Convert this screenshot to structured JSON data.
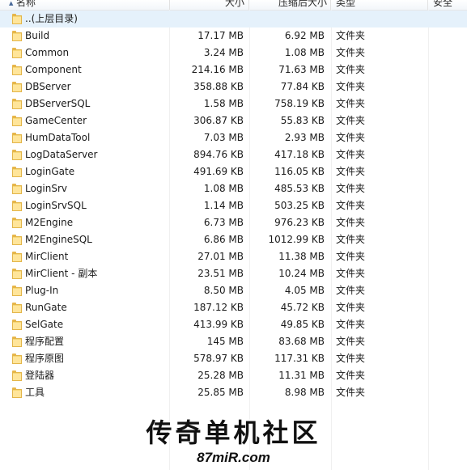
{
  "columns": {
    "name": "名称",
    "size": "大小",
    "compressed": "压缩后大小",
    "type": "类型",
    "security": "安全"
  },
  "parent": {
    "label": "..(上层目录)",
    "icon": "folder-icon"
  },
  "rows": [
    {
      "name": "Build",
      "size": "17.17 MB",
      "compressed": "6.92 MB",
      "type": "文件夹"
    },
    {
      "name": "Common",
      "size": "3.24 MB",
      "compressed": "1.08 MB",
      "type": "文件夹"
    },
    {
      "name": "Component",
      "size": "214.16 MB",
      "compressed": "71.63 MB",
      "type": "文件夹"
    },
    {
      "name": "DBServer",
      "size": "358.88 KB",
      "compressed": "77.84 KB",
      "type": "文件夹"
    },
    {
      "name": "DBServerSQL",
      "size": "1.58 MB",
      "compressed": "758.19 KB",
      "type": "文件夹"
    },
    {
      "name": "GameCenter",
      "size": "306.87 KB",
      "compressed": "55.83 KB",
      "type": "文件夹"
    },
    {
      "name": "HumDataTool",
      "size": "7.03 MB",
      "compressed": "2.93 MB",
      "type": "文件夹"
    },
    {
      "name": "LogDataServer",
      "size": "894.76 KB",
      "compressed": "417.18 KB",
      "type": "文件夹"
    },
    {
      "name": "LoginGate",
      "size": "491.69 KB",
      "compressed": "116.05 KB",
      "type": "文件夹"
    },
    {
      "name": "LoginSrv",
      "size": "1.08 MB",
      "compressed": "485.53 KB",
      "type": "文件夹"
    },
    {
      "name": "LoginSrvSQL",
      "size": "1.14 MB",
      "compressed": "503.25 KB",
      "type": "文件夹"
    },
    {
      "name": "M2Engine",
      "size": "6.73 MB",
      "compressed": "976.23 KB",
      "type": "文件夹"
    },
    {
      "name": "M2EngineSQL",
      "size": "6.86 MB",
      "compressed": "1012.99 KB",
      "type": "文件夹"
    },
    {
      "name": "MirClient",
      "size": "27.01 MB",
      "compressed": "11.38 MB",
      "type": "文件夹"
    },
    {
      "name": "MirClient - 副本",
      "size": "23.51 MB",
      "compressed": "10.24 MB",
      "type": "文件夹"
    },
    {
      "name": "Plug-In",
      "size": "8.50 MB",
      "compressed": "4.05 MB",
      "type": "文件夹"
    },
    {
      "name": "RunGate",
      "size": "187.12 KB",
      "compressed": "45.72 KB",
      "type": "文件夹"
    },
    {
      "name": "SelGate",
      "size": "413.99 KB",
      "compressed": "49.85 KB",
      "type": "文件夹"
    },
    {
      "name": "程序配置",
      "size": "145 MB",
      "compressed": "83.68 MB",
      "type": "文件夹"
    },
    {
      "name": "程序原图",
      "size": "578.97 KB",
      "compressed": "117.31 KB",
      "type": "文件夹"
    },
    {
      "name": "登陆器",
      "size": "25.28 MB",
      "compressed": "11.31 MB",
      "type": "文件夹"
    },
    {
      "name": "工具",
      "size": "25.85 MB",
      "compressed": "8.98 MB",
      "type": "文件夹"
    }
  ],
  "watermark": {
    "title": "传奇单机社区",
    "url": "87miR.com"
  },
  "colors": {
    "selected_row": "#e5f1fb",
    "folder": "#f7d775"
  }
}
